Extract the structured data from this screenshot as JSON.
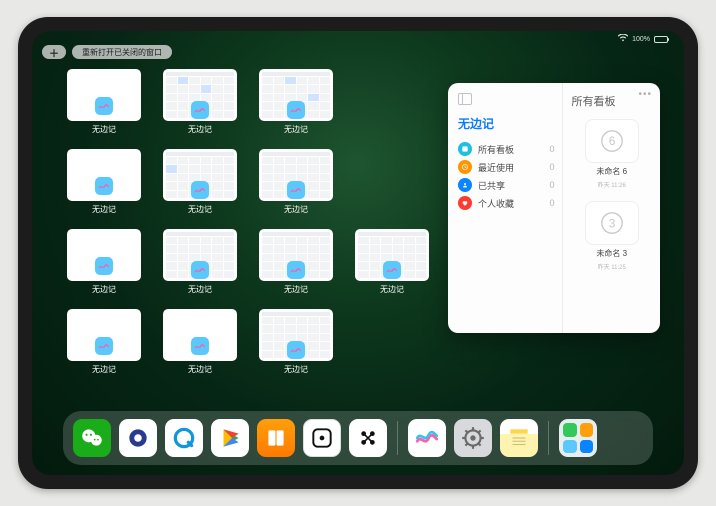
{
  "status": {
    "wifi": "wifi-icon",
    "battery_pct": "100%"
  },
  "top": {
    "reopen_label": "重新打开已关闭的窗口"
  },
  "switcher_app_label": "无边记",
  "modal": {
    "left_title": "无边记",
    "rows": [
      {
        "icon_color": "#1fc0de",
        "label": "所有看板",
        "count": "0"
      },
      {
        "icon_color": "#ff9500",
        "label": "最近使用",
        "count": "0"
      },
      {
        "icon_color": "#0a84ff",
        "label": "已共享",
        "count": "0"
      },
      {
        "icon_color": "#ff3b30",
        "label": "个人收藏",
        "count": "0"
      }
    ],
    "right_title": "所有看板",
    "boards": [
      {
        "glyph": "6",
        "name": "未命名 6",
        "sub": "昨天 11:26"
      },
      {
        "glyph": "3",
        "name": "未命名 3",
        "sub": "昨天 11:25"
      }
    ]
  },
  "dock": [
    {
      "name": "wechat",
      "bg": "#1aad19"
    },
    {
      "name": "app-blue-circle",
      "bg": "#ffffff"
    },
    {
      "name": "qq-browser",
      "bg": "#ffffff"
    },
    {
      "name": "play",
      "bg": "#ffffff"
    },
    {
      "name": "books",
      "bg": "#ff9500"
    },
    {
      "name": "dice",
      "bg": "#ffffff"
    },
    {
      "name": "dots",
      "bg": "#ffffff"
    },
    {
      "name": "freeform",
      "bg": "#ffffff"
    },
    {
      "name": "settings",
      "bg": "#d7d9dc"
    },
    {
      "name": "notes",
      "bg": "#fff8d6"
    },
    {
      "name": "app-library",
      "bg": "#e6eef0"
    }
  ]
}
